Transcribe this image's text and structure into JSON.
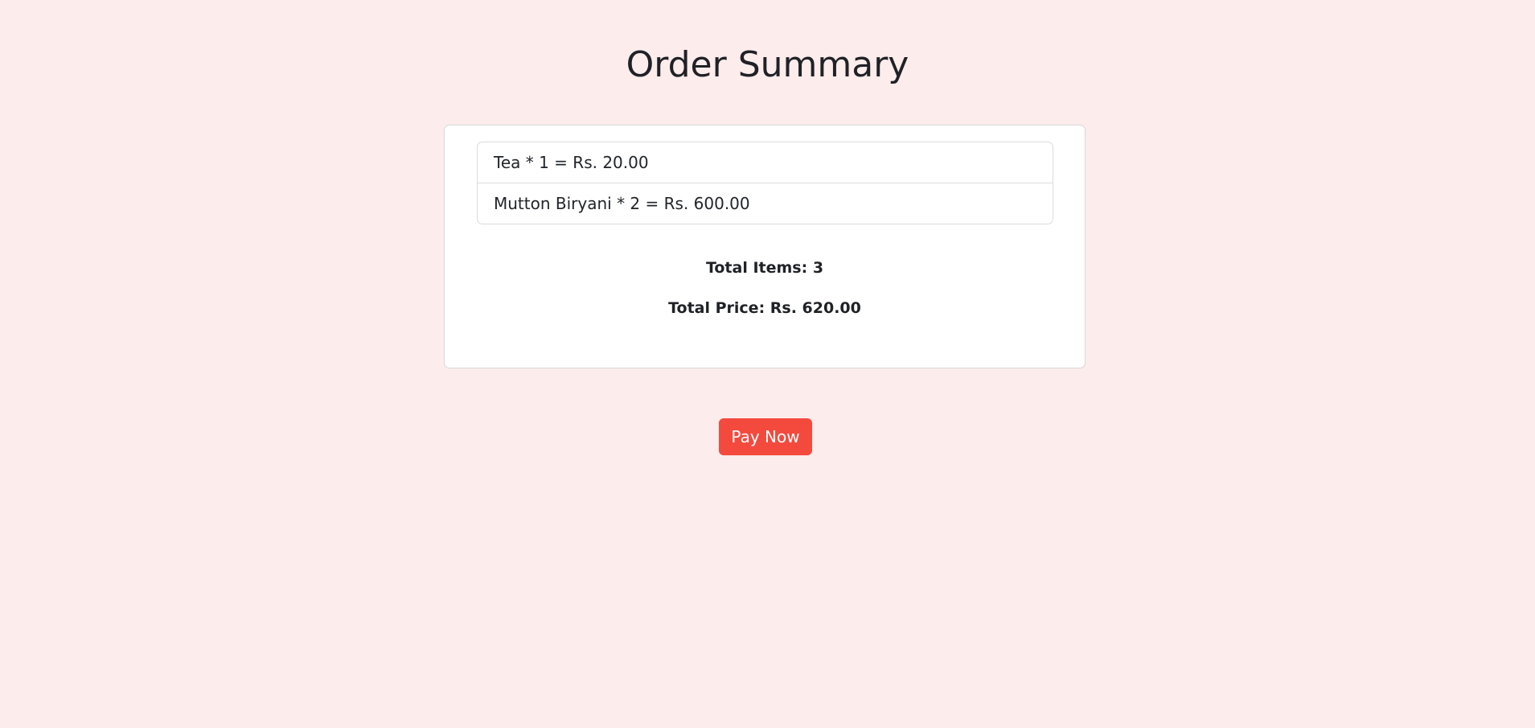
{
  "page": {
    "title": "Order Summary"
  },
  "order": {
    "items": [
      {
        "text": "Tea * 1 = Rs. 20.00"
      },
      {
        "text": "Mutton Biryani * 2 = Rs. 600.00"
      }
    ],
    "total_items": "Total Items: 3",
    "total_price": "Total Price: Rs. 620.00"
  },
  "actions": {
    "pay_label": "Pay Now"
  },
  "colors": {
    "background": "#fcecec",
    "card": "#ffffff",
    "accent": "#f44a3e",
    "text": "#212529"
  }
}
